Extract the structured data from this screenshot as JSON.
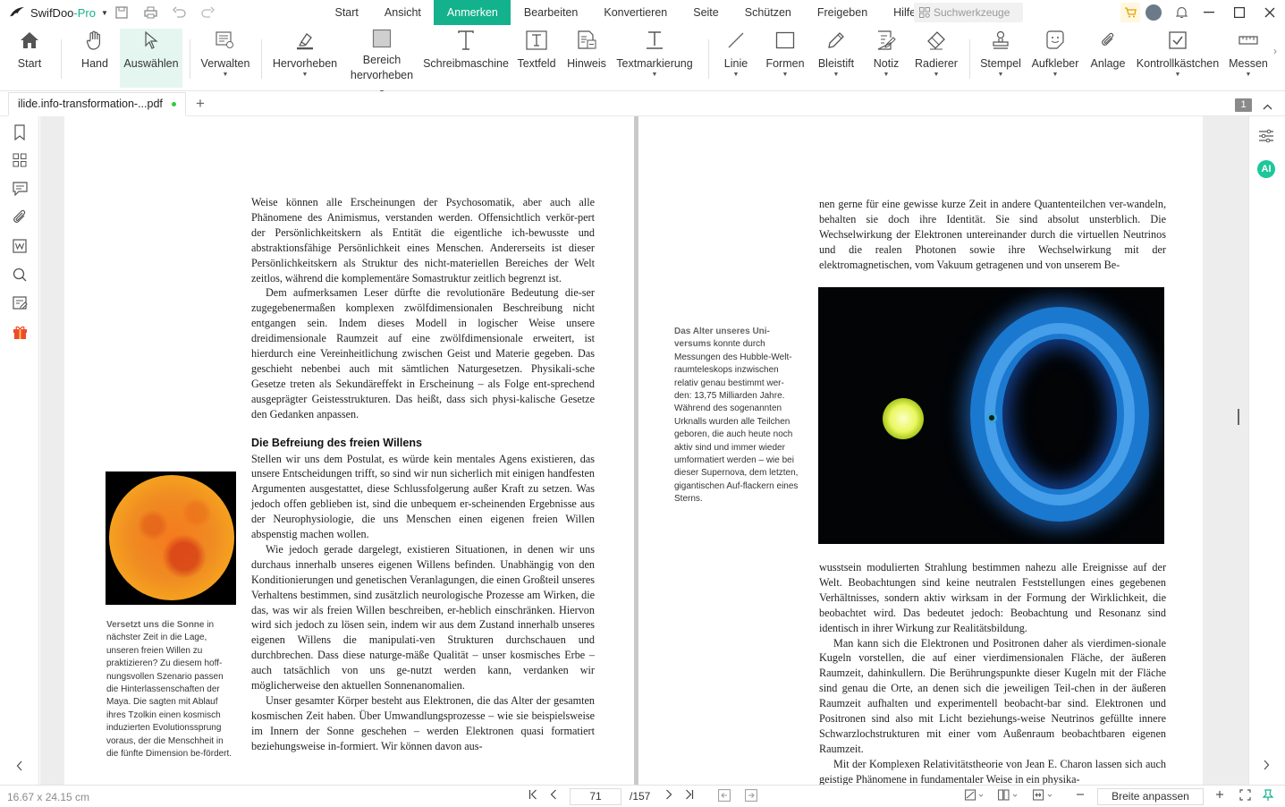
{
  "app": {
    "name": "SwifDoo",
    "edition": "-Pro"
  },
  "menu": [
    {
      "label": "Start",
      "active": false
    },
    {
      "label": "Ansicht",
      "active": false
    },
    {
      "label": "Anmerken",
      "active": true
    },
    {
      "label": "Bearbeiten",
      "active": false
    },
    {
      "label": "Konvertieren",
      "active": false
    },
    {
      "label": "Seite",
      "active": false
    },
    {
      "label": "Schützen",
      "active": false
    },
    {
      "label": "Freigeben",
      "active": false
    },
    {
      "label": "Hilfe",
      "active": false
    }
  ],
  "search": {
    "placeholder": "Suchwerkzeuge"
  },
  "toolbar": {
    "start": "Start",
    "hand": "Hand",
    "select": "Auswählen",
    "manage": "Verwalten",
    "highlight": "Hervorheben",
    "area_highlight_1": "Bereich",
    "area_highlight_2": "hervorheben",
    "typewriter": "Schreibmaschine",
    "textfield": "Textfeld",
    "note": "Hinweis",
    "textmark": "Textmarkierung",
    "line": "Linie",
    "shapes": "Formen",
    "pencil": "Bleistift",
    "memo": "Notiz",
    "eraser": "Radierer",
    "stamp": "Stempel",
    "sticker": "Aufkleber",
    "attachment": "Anlage",
    "checkbox": "Kontrollkästchen",
    "measure": "Messen"
  },
  "tab": {
    "filename": "ilide.info-transformation-...pdf"
  },
  "page_badge": "1",
  "right_panel": {
    "ai_label": "AI"
  },
  "page_left": {
    "caption_head": "Versetzt uns die Sonne",
    "caption_body": "in nächster Zeit in die Lage, unseren freien Willen zu praktizieren? Zu diesem hoff-nungsvollen Szenario passen die Hinterlassenschaften der Maya. Die sagten mit Ablauf ihres Tzolkin einen kosmisch induzierten Evolutionssprung voraus, der die Menschheit in die fünfte Dimension be-fördert.",
    "para1": "Weise können alle Erscheinungen der Psychosomatik, aber auch alle Phänomene des Animismus, verstanden werden. Offensichtlich verkör-pert der Persönlichkeitskern als Entität die eigentliche ich-bewusste und abstraktionsfähige Persönlichkeit eines Menschen. Andererseits ist dieser Persönlichkeitskern als Struktur des nicht-materiellen Bereiches der Welt zeitlos, während die komplementäre Somastruktur zeitlich begrenzt ist.",
    "para2": "Dem aufmerksamen Leser dürfte die revolutionäre Bedeutung die-ser zugegebenermaßen komplexen zwölfdimensionalen Beschreibung nicht entgangen sein. Indem dieses Modell in logischer Weise unsere dreidimensionale Raumzeit auf eine zwölfdimensionale erweitert, ist hierdurch eine Vereinheitlichung zwischen Geist und Materie gegeben. Das geschieht nebenbei auch mit sämtlichen Naturgesetzen. Physikali-sche Gesetze treten als Sekundäreffekt in Erscheinung – als Folge ent-sprechend ausgeprägter Geistesstrukturen. Das heißt, dass sich physi-kalische Gesetze den Gedanken anpassen.",
    "heading": "Die Befreiung des freien Willens",
    "para3": "Stellen wir uns dem Postulat, es würde kein mentales Agens existieren, das unsere Entscheidungen trifft, so sind wir nun sicherlich mit einigen handfesten Argumenten ausgestattet, diese Schlussfolgerung außer Kraft zu setzen. Was jedoch offen geblieben ist, sind die unbequem er-scheinenden Ergebnisse aus der Neurophysiologie, die uns Menschen einen eigenen freien Willen abspenstig machen wollen.",
    "para4": "Wie jedoch gerade dargelegt, existieren Situationen, in denen wir uns durchaus innerhalb unseres eigenen Willens befinden. Unabhängig von den Konditionierungen und genetischen Veranlagungen, die einen Großteil unseres Verhaltens bestimmen, sind zusätzlich neurologische Prozesse am Wirken, die das, was wir als freien Willen beschreiben, er-heblich einschränken. Hiervon wird sich jedoch zu lösen sein, indem wir aus dem Zustand innerhalb unseres eigenen Willens die manipulati-ven Strukturen durchschauen und durchbrechen. Dass diese naturge-mäße Qualität – unser kosmisches Erbe – auch tatsächlich von uns ge-nutzt werden kann, verdanken wir möglicherweise den aktuellen Sonnenanomalien.",
    "para5": "Unser gesamter Körper besteht aus Elektronen, die das Alter der gesamten kosmischen Zeit haben. Über Umwandlungsprozesse – wie sie beispielsweise im Innern der Sonne geschehen – werden Elektronen quasi formatiert beziehungsweise in-formiert. Wir können davon aus-"
  },
  "page_right": {
    "para1": "nen gerne für eine gewisse kurze Zeit in andere Quantenteilchen ver-wandeln, behalten sie doch ihre Identität. Sie sind absolut unsterblich. Die Wechselwirkung der Elektronen untereinander durch die virtuellen Neutrinos und die realen Photonen sowie ihre Wechselwirkung mit der elektromagnetischen, vom Vakuum getragenen und von unserem Be-",
    "caption_head": "Das Alter unseres Uni-versums",
    "caption_body": "konnte durch Messungen des Hubble-Welt-raumteleskops inzwischen relativ genau bestimmt wer-den: 13,75 Milliarden Jahre. Während des sogenannten Urknalls wurden alle Teilchen geboren, die auch heute noch aktiv sind und immer wieder umformatiert werden – wie bei dieser Supernova, dem letzten, gigantischen Auf-flackern eines Sterns.",
    "para2": "wusstsein modulierten Strahlung bestimmen nahezu alle Ereignisse auf der Welt. Beobachtungen sind keine neutralen Feststellungen eines gegebenen Verhältnisses, sondern aktiv wirksam in der Formung der Wirklichkeit, die beobachtet wird. Das bedeutet jedoch: Beobachtung und Resonanz sind identisch in ihrer Wirkung zur Realitätsbildung.",
    "para3": "Man kann sich die Elektronen und Positronen daher als vierdimen-sionale Kugeln vorstellen, die auf einer vierdimensionalen Fläche, der äußeren Raumzeit, dahinkullern. Die Berührungspunkte dieser Kugeln mit der Fläche sind genau die Orte, an denen sich die jeweiligen Teil-chen in der äußeren Raumzeit aufhalten und experimentell beobacht-bar sind. Elektronen und Positronen sind also mit Licht beziehungs-weise Neutrinos gefüllte innere Schwarzlochstrukturen mit einer vom Außenraum beobachtbaren eigenen Raumzeit.",
    "para4": "Mit der Komplexen Relativitätstheorie von Jean E. Charon lassen sich auch geistige Phänomene in fundamentaler Weise in ein physika-"
  },
  "status": {
    "dimensions": "16.67 x 24.15 cm",
    "page_current": "71",
    "page_total": "/157",
    "zoom_mode": "Breite anpassen"
  },
  "colors": {
    "accent": "#13b28c"
  }
}
